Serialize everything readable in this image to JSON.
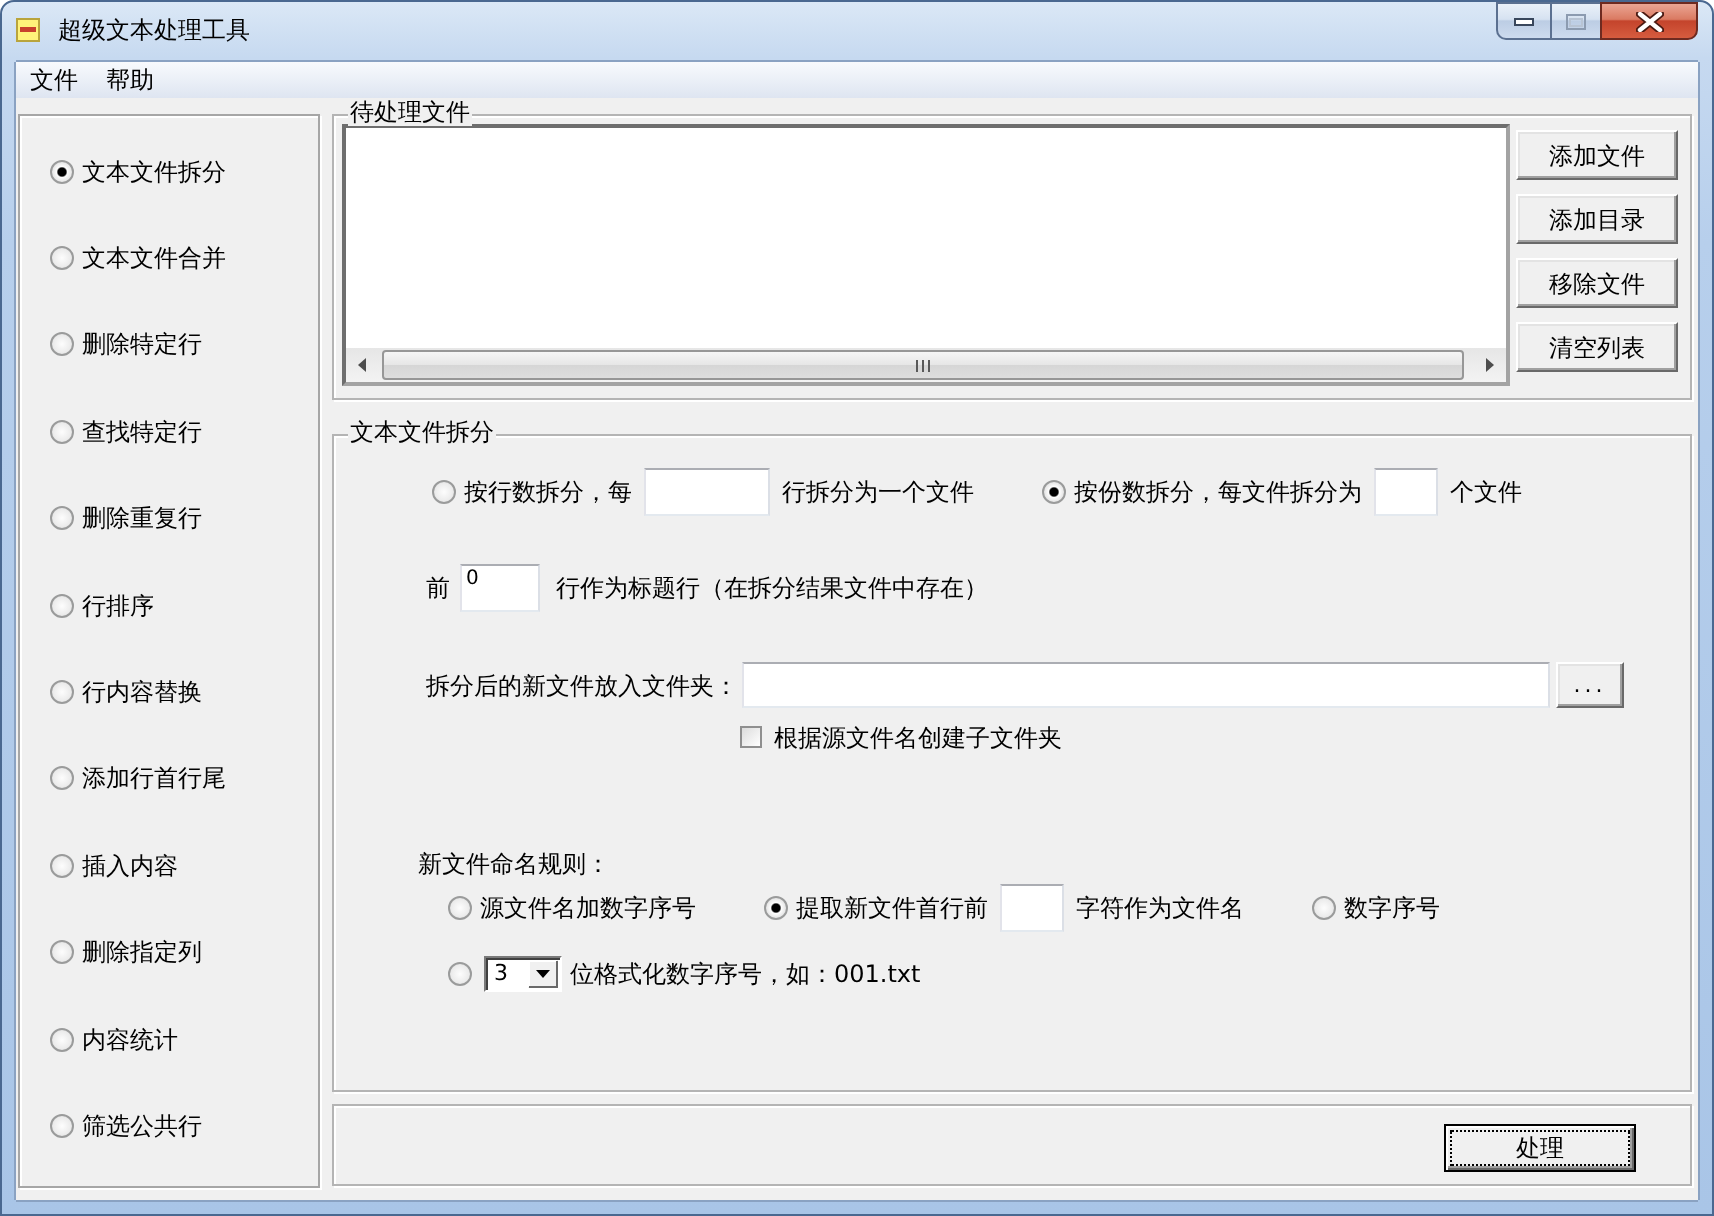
{
  "window": {
    "title": "超级文本处理工具"
  },
  "menu": [
    "文件",
    "帮助"
  ],
  "sidebar": {
    "items": [
      {
        "label": "文本文件拆分",
        "selected": true
      },
      {
        "label": "文本文件合并",
        "selected": false
      },
      {
        "label": "删除特定行",
        "selected": false
      },
      {
        "label": "查找特定行",
        "selected": false
      },
      {
        "label": "删除重复行",
        "selected": false
      },
      {
        "label": "行排序",
        "selected": false
      },
      {
        "label": "行内容替换",
        "selected": false
      },
      {
        "label": "添加行首行尾",
        "selected": false
      },
      {
        "label": "插入内容",
        "selected": false
      },
      {
        "label": "删除指定列",
        "selected": false
      },
      {
        "label": "内容统计",
        "selected": false
      },
      {
        "label": "筛选公共行",
        "selected": false
      }
    ]
  },
  "file_list": {
    "title": "待处理文件",
    "buttons": [
      "添加文件",
      "添加目录",
      "移除文件",
      "清空列表"
    ]
  },
  "split_panel": {
    "title": "文本文件拆分",
    "modes": [
      {
        "label": "按行数拆分，每",
        "suffix": "行拆分为一个文件",
        "selected": false
      },
      {
        "label": "按份数拆分，每文件拆分为",
        "suffix": "个文件",
        "selected": true
      }
    ],
    "header_rows": {
      "label": "前",
      "value": "0",
      "suffix": "行作为标题行（在拆分结果文件中存在）"
    },
    "output_folder": {
      "label": "拆分后的新文件放入文件夹：",
      "browse_button": "...",
      "subfolder_checkbox": {
        "label": "根据源文件名创建子文件夹",
        "checked": false
      }
    },
    "naming": {
      "title": "新文件命名规则：",
      "rows": [
        {
          "options": [
            {
              "kind": "plain",
              "label": "源文件名加数字序号",
              "selected": false
            },
            {
              "kind": "field",
              "label": "提取新文件首行前",
              "suffix": "字符作为文件名",
              "selected": true
            },
            {
              "kind": "plain",
              "label": "数字序号",
              "selected": false
            }
          ]
        },
        {
          "options": [
            {
              "kind": "dropdown",
              "value": "3",
              "suffix": "位格式化数字序号，如：001.txt",
              "selected": false
            }
          ]
        }
      ]
    }
  },
  "process_button": {
    "label": "处理",
    "focused": true
  }
}
